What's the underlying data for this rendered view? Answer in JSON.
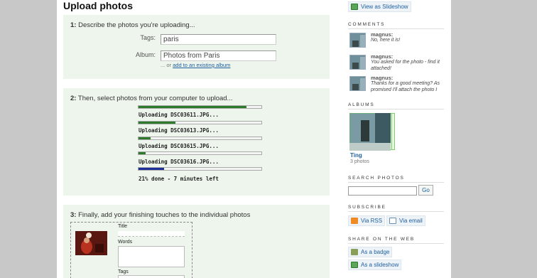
{
  "page_title": "Upload photos",
  "step1": {
    "number": "1:",
    "text": "Describe the photos you're uploading...",
    "tags_label": "Tags:",
    "tags_value": "paris",
    "album_label": "Album:",
    "album_value": "Photos from Paris",
    "hint_prefix": "... or",
    "hint_link": "add to an existing album"
  },
  "step2": {
    "number": "2:",
    "text": "Then, select photos from your computer to upload...",
    "uploads": [
      {
        "label": "Uploading DSC03611.JPG...",
        "progress": 0.88
      },
      {
        "label": "Uploading DSC03613.JPG...",
        "progress": 0.3
      },
      {
        "label": "Uploading DSC03615.JPG...",
        "progress": 0.1
      },
      {
        "label": "Uploading DSC03616.JPG...",
        "progress": 0.06
      }
    ],
    "total_progress": 0.21,
    "total_label": "21% done - 7 minutes left"
  },
  "step3": {
    "number": "3:",
    "text": "Finally, add your finishing touches to the individual photos",
    "title_label": "Title",
    "words_label": "Words",
    "tags_label": "Tags"
  },
  "sidebar": {
    "slideshow_top": "View as Slideshow",
    "comments_title": "COMMENTS",
    "comments": [
      {
        "author": "magnus:",
        "text": "No, here it is!"
      },
      {
        "author": "magnus:",
        "text": "You asked for the photo - find it attached!"
      },
      {
        "author": "magnus:",
        "text": "Thanks for a good meeting? As promised I'll attach the photo I"
      }
    ],
    "albums_title": "ALBUMS",
    "album_name": "Ting",
    "album_count": "3 photos",
    "search_title": "SEARCH PHOTOS",
    "search_button": "Go",
    "subscribe_title": "SUBSCRIBE",
    "via_rss": "Via RSS",
    "via_email": "Via email",
    "share_title": "SHARE ON THE WEB",
    "as_badge": "As a badge",
    "as_slideshow": "As a slideshow"
  },
  "colors": {
    "panel_bg": "#edf5ec",
    "progress_green": "#2d7a2d",
    "progress_blue": "#1e2f9a",
    "link": "#2060a0"
  }
}
